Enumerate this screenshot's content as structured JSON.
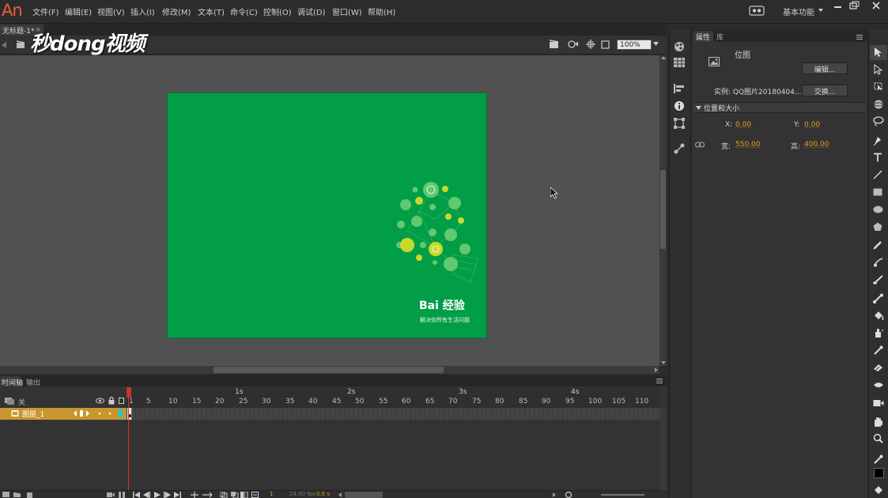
{
  "app": {
    "logo": "An"
  },
  "menu": [
    "文件(F)",
    "编辑(E)",
    "视图(V)",
    "插入(I)",
    "修改(M)",
    "文本(T)",
    "命令(C)",
    "控制(O)",
    "调试(D)",
    "窗口(W)",
    "帮助(H)"
  ],
  "workspace": {
    "label": "基本功能"
  },
  "document": {
    "tab": "无标题-1*",
    "close": "×"
  },
  "watermark": "秒dong视频",
  "editbar": {
    "zoom": "100%"
  },
  "stage": {
    "brand": "Bai 经验",
    "tagline": "解决你所有生活问题",
    "color": "#029d47"
  },
  "timeline": {
    "tabs": [
      "时间轴",
      "输出"
    ],
    "layer_header": "关",
    "seconds": [
      "1s",
      "2s",
      "3s",
      "4s"
    ],
    "ticks": [
      "1",
      "5",
      "10",
      "15",
      "20",
      "25",
      "30",
      "35",
      "40",
      "45",
      "50",
      "55",
      "60",
      "65",
      "70",
      "75",
      "80",
      "85",
      "90",
      "95",
      "100",
      "105",
      "110"
    ],
    "layer": {
      "name": "图层_1",
      "color": "#00d2e0"
    },
    "current_frame": "1",
    "fps": "24.00 fps",
    "time": "0.0 s"
  },
  "properties": {
    "tabs": [
      "属性",
      "库"
    ],
    "type_label": "位图",
    "edit_button": "编辑...",
    "instance_text": "实例: QQ图片20180404...",
    "swap_button": "交换...",
    "section_title": "位置和大小",
    "x_label": "X:",
    "x_value": "0.00",
    "y_label": "Y:",
    "y_value": "0.00",
    "w_label": "宽:",
    "w_value": "550.00",
    "h_label": "高:",
    "h_value": "400.00"
  },
  "colors": {
    "accent": "#e8603c",
    "value": "#e0a020",
    "layer_row": "#c8952e",
    "playhead": "#dd3333"
  }
}
